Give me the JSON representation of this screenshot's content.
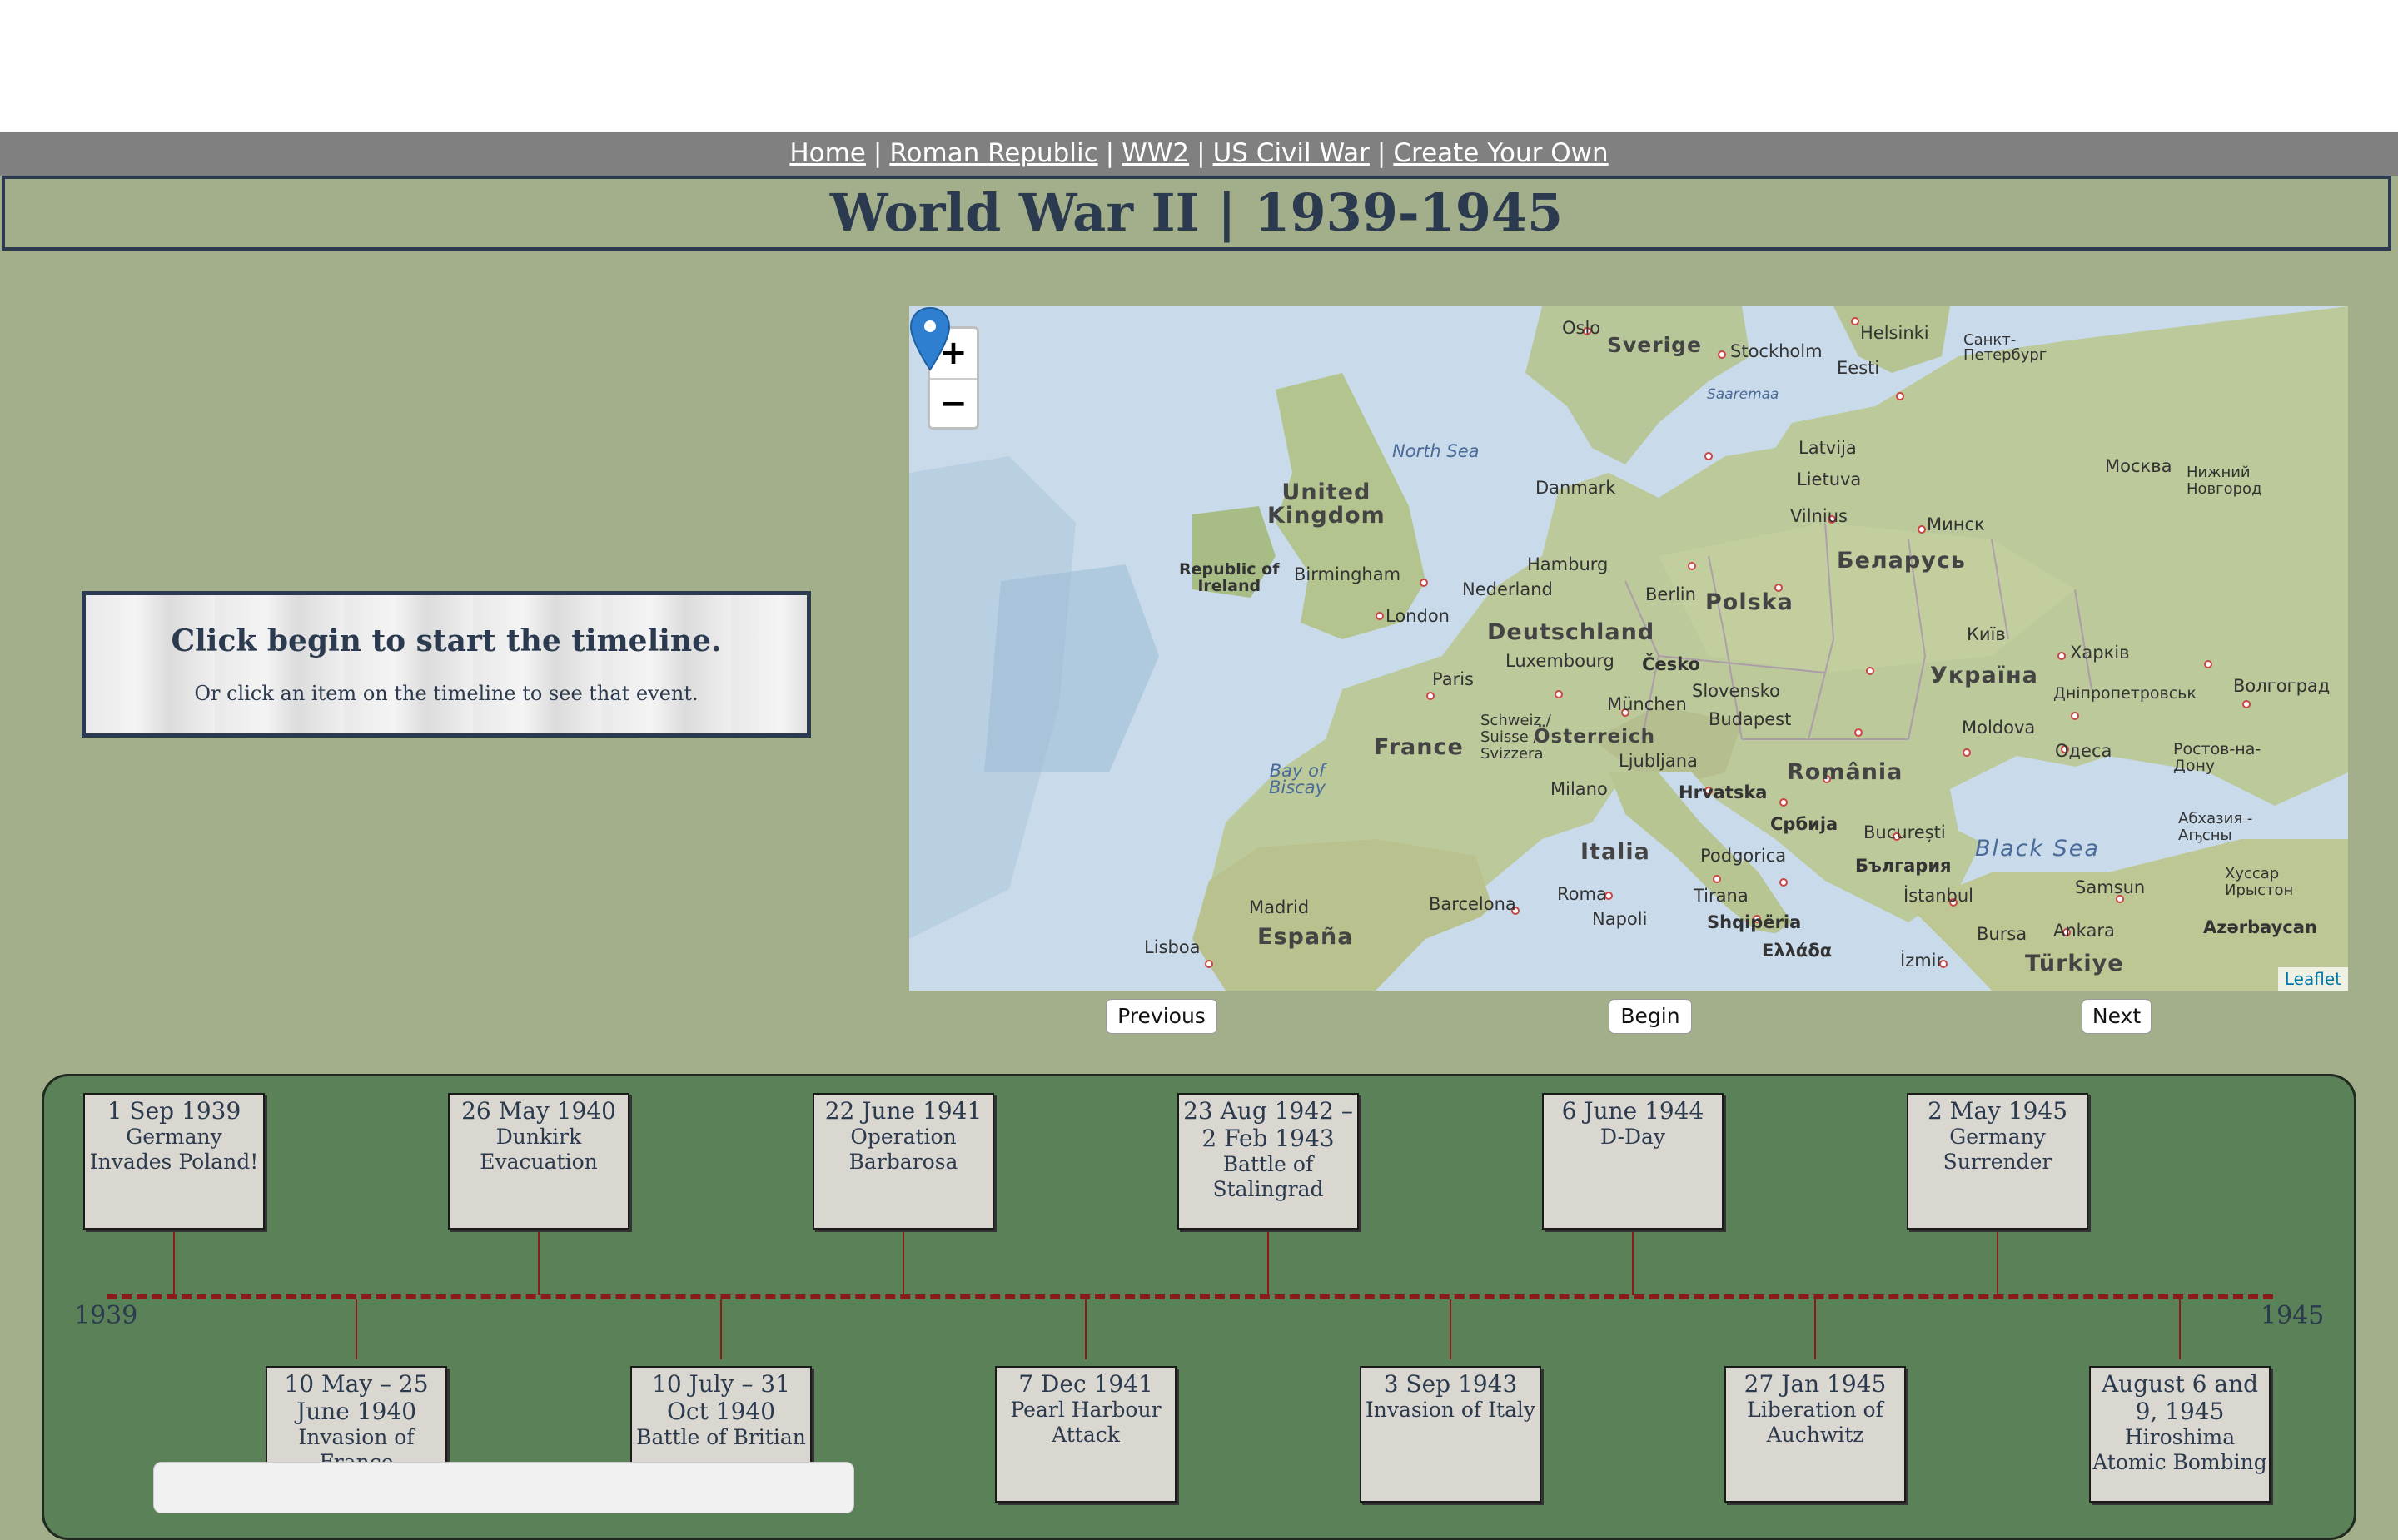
{
  "nav": {
    "links": [
      "Home",
      "Roman Republic",
      "WW2",
      "US Civil War",
      "Create Your Own"
    ],
    "separator": "|"
  },
  "title": "World War II | 1939-1945",
  "info": {
    "heading": "Click begin to start the timeline.",
    "sub": "Or click an item on the timeline to see that event."
  },
  "map": {
    "zoom_in": "+",
    "zoom_out": "−",
    "attribution": "Leaflet",
    "marker_icon": "map-marker-icon",
    "labels": {
      "oslo": "Oslo",
      "sverige": "Sverige",
      "stockholm": "Stockholm",
      "helsinki": "Helsinki",
      "petersburg": "Санкт-\nПетербург",
      "eesti": "Eesti",
      "saaremaa": "Saaremaa",
      "north_sea": "North Sea",
      "latvija": "Latvija",
      "moskva": "Москва",
      "nizhny": "Нижний\nНовгород",
      "uk": "United\nKingdom",
      "danmark": "Danmark",
      "lietuva": "Lietuva",
      "vilnius": "Vilnius",
      "minsk": "Минск",
      "belarus": "Беларусь",
      "ireland": "Republic of\nIreland",
      "birmingham": "Birmingham",
      "hamburg": "Hamburg",
      "nederland": "Nederland",
      "berlin": "Berlin",
      "polska": "Polska",
      "london": "London",
      "deutschland": "Deutschland",
      "kyiv": "Київ",
      "kharkiv": "Харків",
      "luxembourg": "Luxembourg",
      "cesko": "Česko",
      "ukraina": "Україна",
      "paris": "Paris",
      "slovensko": "Slovensko",
      "dnipro": "Дніпропетровськ",
      "volgograd": "Волгоград",
      "schweiz": "Schweiz /\nSuisse /\nSvizzera",
      "munchen": "München",
      "budapest": "Budapest",
      "moldova": "Moldova",
      "osterreich": "Österreich",
      "france": "France",
      "odesa": "Одеса",
      "rostov": "Ростов-на-\nДону",
      "ljubljana": "Ljubljana",
      "romania": "România",
      "biscay": "Bay of\nBiscay",
      "milano": "Milano",
      "hrvatska": "Hrvatska",
      "srbija": "Србија",
      "bucuresti": "București",
      "abkhazia": "Абхазия -\nАҧсны",
      "italia": "Italia",
      "podgorica": "Podgorica",
      "bulgaria": "България",
      "black_sea": "Black Sea",
      "khusar": "Хуссар\nИрыстон",
      "roma": "Roma",
      "tirana": "Tirana",
      "istanbul": "İstanbul",
      "samsun": "Samsun",
      "barcelona": "Barcelona",
      "madrid": "Madrid",
      "napoli": "Napoli",
      "shqiperia": "Shqipëria",
      "bursa": "Bursa",
      "ankara": "Ankara",
      "azerbaycan": "Azərbaycan",
      "espana": "España",
      "lisboa": "Lisboa",
      "ellada": "Ελλάδα",
      "izmir": "İzmir",
      "turkiye": "Türkiye"
    }
  },
  "controls": {
    "previous": "Previous",
    "begin": "Begin",
    "next": "Next"
  },
  "timeline": {
    "start_year": "1939",
    "end_year": "1945",
    "top_events": [
      {
        "date": "1 Sep 1939",
        "name": "Germany Invades Poland!"
      },
      {
        "date": "26 May 1940",
        "name": "Dunkirk Evacuation"
      },
      {
        "date": "22 June 1941",
        "name": "Operation Barbarosa"
      },
      {
        "date": "23 Aug 1942 – 2 Feb 1943",
        "name": "Battle of Stalingrad"
      },
      {
        "date": "6 June 1944",
        "name": "D-Day"
      },
      {
        "date": "2 May 1945",
        "name": "Germany Surrender"
      }
    ],
    "bottom_events": [
      {
        "date": "10 May – 25 June 1940",
        "name": "Invasion of France"
      },
      {
        "date": "10 July – 31 Oct 1940",
        "name": "Battle of Britian"
      },
      {
        "date": "7 Dec 1941",
        "name": "Pearl Harbour Attack"
      },
      {
        "date": "3 Sep 1943",
        "name": "Invasion of Italy"
      },
      {
        "date": "27 Jan 1945",
        "name": "Liberation of Auchwitz"
      },
      {
        "date": "August 6 and 9, 1945",
        "name": "Hiroshima Atomic Bombing"
      }
    ]
  },
  "colors": {
    "background": "#a3af8a",
    "timeline_bg": "#5b8159",
    "axis": "#8b1a1a",
    "title": "#2b3a4e",
    "navbar": "#808080"
  }
}
